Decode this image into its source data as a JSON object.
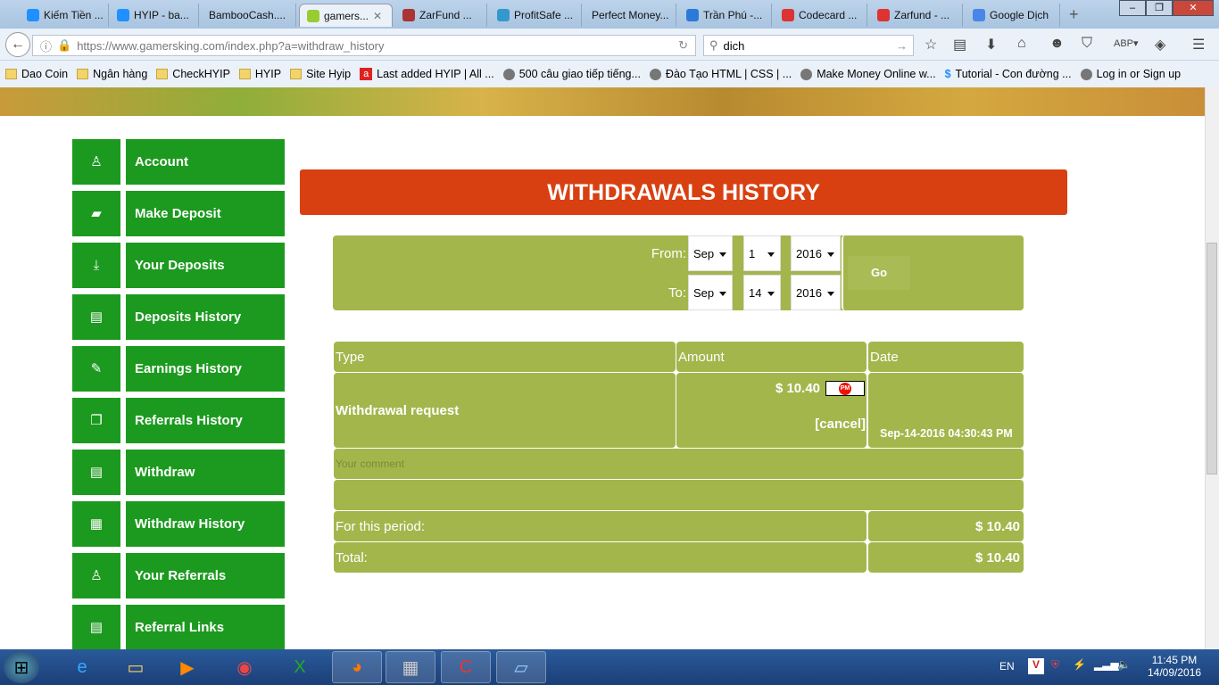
{
  "browser": {
    "tabs": [
      {
        "label": "Kiếm Tiền ...",
        "color": "#1e90ff"
      },
      {
        "label": "HYIP - ba...",
        "color": "#1e90ff"
      },
      {
        "label": "BambooCash....",
        "color": ""
      },
      {
        "label": "gamers...",
        "color": "#9c3",
        "active": true
      },
      {
        "label": "ZarFund ...",
        "color": "#a33"
      },
      {
        "label": "ProfitSafe ...",
        "color": "#39c"
      },
      {
        "label": "Perfect Money...",
        "color": ""
      },
      {
        "label": "Trần Phú -...",
        "color": "#2a7ad9"
      },
      {
        "label": "Codecard ...",
        "color": "#d33"
      },
      {
        "label": "Zarfund - ...",
        "color": "#d33"
      },
      {
        "label": "Google Dịch",
        "color": "#4a86e8"
      }
    ],
    "url": "https://www.gamersking.com/index.php?a=withdraw_history",
    "search_value": "dich",
    "bookmarks": [
      {
        "label": "Dao Coin",
        "icon": "folder"
      },
      {
        "label": "Ngân hàng",
        "icon": "folder"
      },
      {
        "label": "CheckHYIP",
        "icon": "folder"
      },
      {
        "label": "HYIP",
        "icon": "folder"
      },
      {
        "label": "Site Hyip",
        "icon": "folder"
      },
      {
        "label": "Last added HYIP | All ...",
        "icon": "a"
      },
      {
        "label": "500 câu giao tiếp tiếng...",
        "icon": "globe"
      },
      {
        "label": "Đào Tạo HTML | CSS | ...",
        "icon": "globe"
      },
      {
        "label": "Make Money Online w...",
        "icon": "globe"
      },
      {
        "label": "Tutorial - Con đường ...",
        "icon": "dollar"
      },
      {
        "label": "Log in or Sign up",
        "icon": "globe"
      }
    ]
  },
  "sidebar": [
    {
      "label": "Account",
      "icon": "user-icon",
      "glyph": "♙"
    },
    {
      "label": "Make Deposit",
      "icon": "wallet-icon",
      "glyph": "▰"
    },
    {
      "label": "Your Deposits",
      "icon": "download-icon",
      "glyph": "⤓"
    },
    {
      "label": "Deposits History",
      "icon": "archive-icon",
      "glyph": "▤"
    },
    {
      "label": "Earnings History",
      "icon": "edit-icon",
      "glyph": "✎"
    },
    {
      "label": "Referrals History",
      "icon": "copy-icon",
      "glyph": "❐"
    },
    {
      "label": "Withdraw",
      "icon": "document-icon",
      "glyph": "▤"
    },
    {
      "label": "Withdraw History",
      "icon": "calendar-icon",
      "glyph": "▦"
    },
    {
      "label": "Your Referrals",
      "icon": "user-icon",
      "glyph": "♙"
    },
    {
      "label": "Referral Links",
      "icon": "list-icon",
      "glyph": "▤"
    }
  ],
  "main": {
    "title": "WITHDRAWALS HISTORY",
    "filter": {
      "from_label": "From:",
      "to_label": "To:",
      "from": {
        "month": "Sep",
        "day": "1",
        "year": "2016"
      },
      "to": {
        "month": "Sep",
        "day": "14",
        "year": "2016"
      },
      "go_label": "Go"
    },
    "table": {
      "headers": [
        "Type",
        "Amount",
        "Date"
      ],
      "row": {
        "type": "Withdrawal request",
        "amount": "$ 10.40",
        "processor": "PM",
        "cancel": "[cancel]",
        "date": "Sep-14-2016 04:30:43 PM"
      },
      "comment_placeholder": "Your comment",
      "period_label": "For this period:",
      "period_value": "$ 10.40",
      "total_label": "Total:",
      "total_value": "$ 10.40"
    }
  },
  "taskbar": {
    "lang": "EN",
    "time": "11:45 PM",
    "date": "14/09/2016"
  }
}
